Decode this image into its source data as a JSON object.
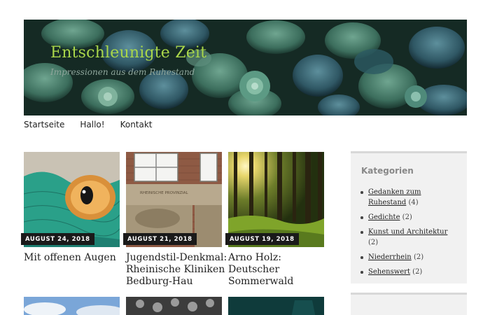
{
  "site": {
    "title": "Entschleunigte Zeit",
    "tagline": "Impressionen aus dem Ruhestand"
  },
  "nav": {
    "items": [
      "Startseite",
      "Hallo!",
      "Kontakt"
    ]
  },
  "posts": [
    {
      "date": "AUGUST 24, 2018",
      "title": "Mit offenen Augen"
    },
    {
      "date": "AUGUST 21, 2018",
      "title": "Jugendstil-Denkmal: Rheinische Kliniken Bedburg-Hau"
    },
    {
      "date": "AUGUST 19, 2018",
      "title": "Arno Holz: Deutscher Sommerwald"
    }
  ],
  "sidebar": {
    "widget_title": "Kategorien",
    "categories": [
      {
        "name": "Gedanken zum Ruhestand",
        "count": "(4)"
      },
      {
        "name": "Gedichte",
        "count": "(2)"
      },
      {
        "name": "Kunst und Architektur",
        "count": "(2)"
      },
      {
        "name": "Niederrhein",
        "count": "(2)"
      },
      {
        "name": "Sehenswert",
        "count": "(2)"
      }
    ]
  },
  "colors": {
    "title_green": "#a9d64a",
    "date_badge": "#1a1a1a",
    "widget_bg": "#f1f1f1"
  }
}
